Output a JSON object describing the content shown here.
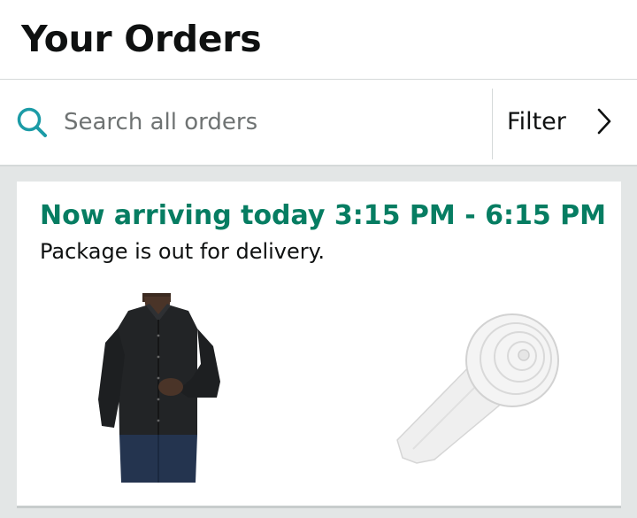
{
  "header": {
    "title": "Your Orders"
  },
  "search": {
    "placeholder": "Search all orders",
    "value": "",
    "icon": "search-icon"
  },
  "filter": {
    "label": "Filter",
    "icon": "chevron-right-icon"
  },
  "order": {
    "arrival": "Now arriving today 3:15 PM - 6:15 PM",
    "status": "Package is out for delivery.",
    "items": [
      {
        "image": "black-button-up-shirt"
      },
      {
        "image": "white-rolled-necktie"
      }
    ]
  },
  "colors": {
    "accent_green": "#067d62",
    "search_icon_teal": "#1b9ba6",
    "background_gray": "#e3e6e6"
  }
}
